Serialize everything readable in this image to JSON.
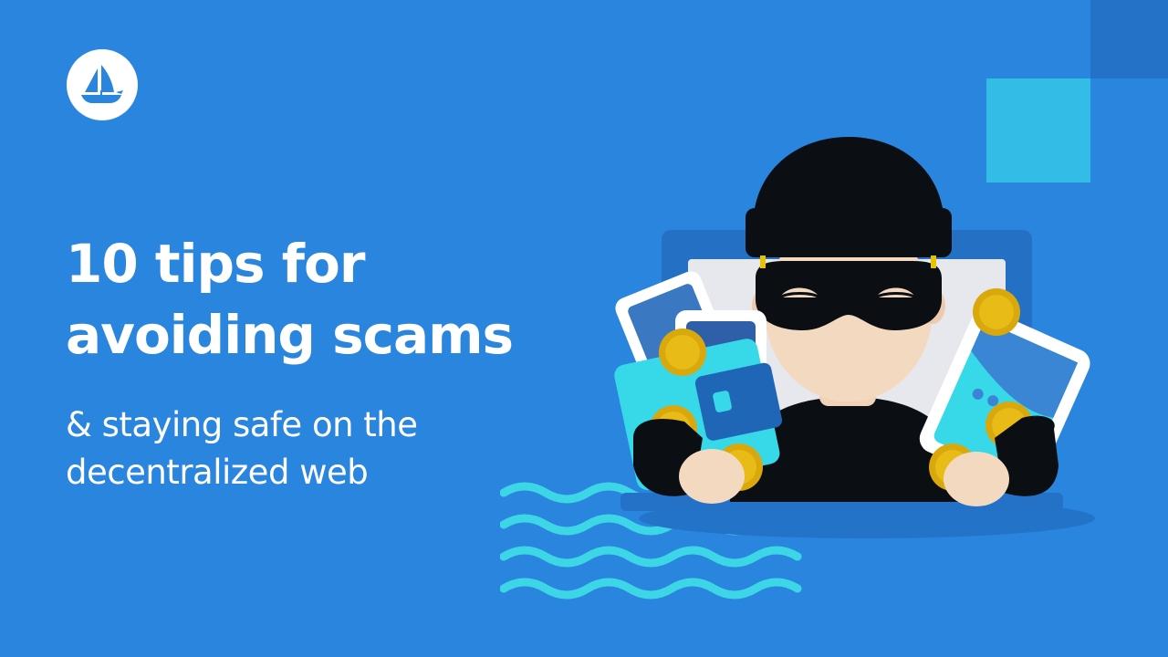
{
  "brand": {
    "logo_icon": "sailboat-icon",
    "logo_bg": "#FFFFFF",
    "logo_color": "#2A85DE"
  },
  "headline": {
    "line1": "10 tips for",
    "line2": "avoiding scams"
  },
  "subheadline": {
    "line1": "& staying safe on the",
    "line2": "decentralized web"
  },
  "colors": {
    "background": "#2A85DE",
    "accent_cyan": "#33BCE6",
    "wave": "#3DD6E6",
    "text": "#FFFFFF"
  },
  "illustration": {
    "subject": "masked-thief-icon",
    "items": [
      "laptop-icon",
      "nft-card-icon",
      "wallet-icon",
      "gold-coin-icon"
    ]
  }
}
